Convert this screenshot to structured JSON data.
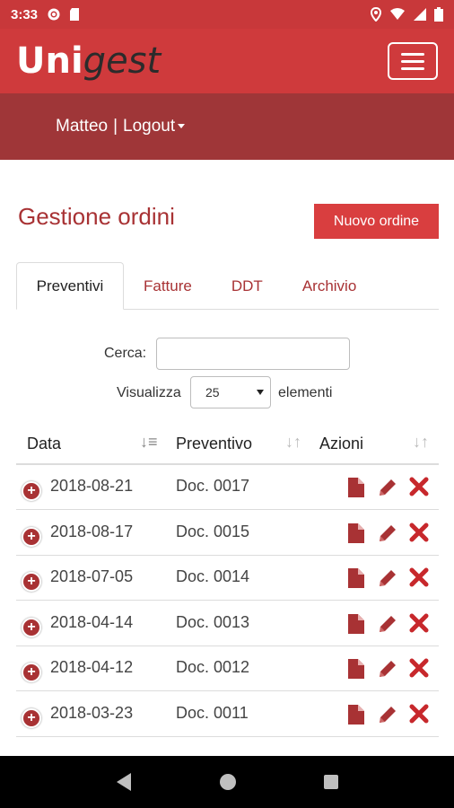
{
  "status": {
    "time": "3:33"
  },
  "app": {
    "logo_main": "Uni",
    "logo_italic": "gest"
  },
  "user": {
    "name": "Matteo",
    "separator": "|",
    "logout": "Logout"
  },
  "page": {
    "title": "Gestione ordini",
    "new_button": "Nuovo ordine"
  },
  "tabs": [
    {
      "label": "Preventivi",
      "active": true
    },
    {
      "label": "Fatture"
    },
    {
      "label": "DDT"
    },
    {
      "label": "Archivio"
    }
  ],
  "search": {
    "label": "Cerca:",
    "value": ""
  },
  "paging": {
    "prefix": "Visualizza",
    "value": "25",
    "suffix": "elementi"
  },
  "table": {
    "headers": [
      "Data",
      "Preventivo",
      "Azioni"
    ],
    "rows": [
      {
        "date": "2018-08-21",
        "doc": "Doc. 0017"
      },
      {
        "date": "2018-08-17",
        "doc": "Doc. 0015"
      },
      {
        "date": "2018-07-05",
        "doc": "Doc. 0014"
      },
      {
        "date": "2018-04-14",
        "doc": "Doc. 0013"
      },
      {
        "date": "2018-04-12",
        "doc": "Doc. 0012"
      },
      {
        "date": "2018-03-23",
        "doc": "Doc. 0011"
      }
    ]
  },
  "colors": {
    "brand": "#cf3a3c",
    "dark": "#9f3638",
    "text_accent": "#a83234"
  },
  "icons": [
    "gear-icon",
    "sd-card-icon",
    "location-icon",
    "wifi-icon",
    "signal-icon",
    "battery-icon",
    "menu-icon",
    "document-icon",
    "edit-icon",
    "delete-icon",
    "back-icon",
    "home-icon",
    "recents-icon"
  ]
}
